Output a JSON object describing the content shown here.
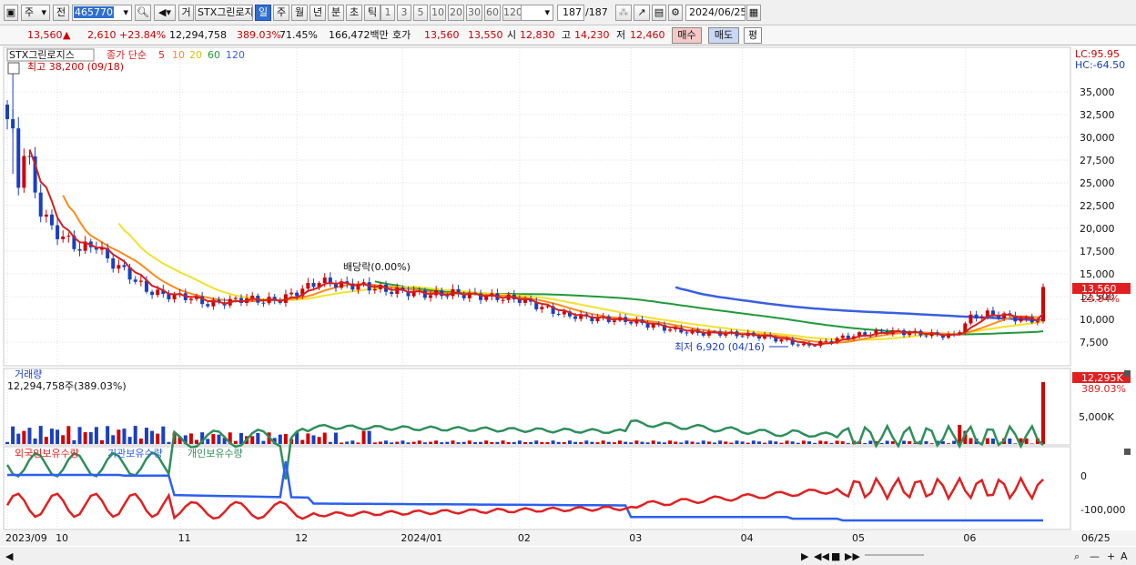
{
  "toolbar": {
    "market_type": "주",
    "market_mode": "전",
    "stock_code": "465770",
    "trade_tab": "거",
    "stock_name": "STX그린로지",
    "periods": [
      "일",
      "주",
      "월",
      "년",
      "분",
      "초",
      "틱"
    ],
    "active_period": "일",
    "intervals": [
      "1",
      "3",
      "5",
      "10",
      "20",
      "30",
      "60",
      "120"
    ],
    "count": "187",
    "total": "/187",
    "date": "2024/06/25"
  },
  "quote": {
    "price": "13,560",
    "change_arrow": "▲",
    "change": "2,610",
    "change_pct": "+23.84%",
    "volume": "12,294,758",
    "volume_ratio": "389.03%",
    "turnover": "71.45%",
    "amount": "166,472백만",
    "ask_label": "호가",
    "ask": "13,560",
    "bid": "13,550",
    "open_label": "시",
    "open": "12,830",
    "high_label": "고",
    "high": "14,230",
    "low_label": "저",
    "low": "12,460",
    "buy_button": "매수",
    "sell_button": "매도",
    "eval_button": "평"
  },
  "colors": {
    "up": "#d00000",
    "down": "#1a3fc0",
    "ma5": "#d32020",
    "ma10": "#ff8a1a",
    "ma20": "#f5e02a",
    "ma60": "#1f9a3a",
    "ma120": "#3a5fe0",
    "foreign": "#e02020",
    "institution": "#2c5ff0",
    "individual": "#2e8f5a"
  },
  "price_panel": {
    "stock_label": "STX그린로지스",
    "ma_label": "종가 단순",
    "ma_periods": [
      "5",
      "10",
      "20",
      "60",
      "120"
    ],
    "high_note": "최고 38,200 (09/18)",
    "low_note": "최저 6,920 (04/16)",
    "dividend_note": "배당락(0.00%)",
    "lc": "LC:95.95",
    "hc": "HC:-64.50",
    "current_price_tag": "13,560",
    "current_pct_tag": "23.84%",
    "y_ticks": [
      "35,000",
      "32,500",
      "30,000",
      "27,500",
      "25,000",
      "22,500",
      "20,000",
      "17,500",
      "15,000",
      "12,500",
      "10,000",
      "7,500"
    ]
  },
  "volume_panel": {
    "title": "거래량",
    "value": "12,294,758주(389.03%)",
    "tag_value": "12,295K",
    "tag_pct": "389.03%",
    "y_tick": "5,000K"
  },
  "holdings_panel": {
    "series_names": [
      "외국인보유수량",
      "기관보유수량",
      "개인보유수량"
    ],
    "y_ticks": [
      "0",
      "-100,000"
    ]
  },
  "x_axis": {
    "labels": [
      "2023/09",
      "10",
      "11",
      "12",
      "2024/01",
      "02",
      "03",
      "04",
      "05",
      "06"
    ],
    "right_label": "06/25"
  },
  "chart_data": {
    "type": "candlestick",
    "title": "",
    "ylim": [
      5500,
      38200
    ],
    "y_ticks": [
      7500,
      10000,
      12500,
      15000,
      17500,
      20000,
      22500,
      25000,
      27500,
      30000,
      32500,
      35000
    ],
    "annotations": [
      {
        "text": "최고 38,200 (09/18)",
        "value": 38200
      },
      {
        "text": "최저 6,920 (04/16)",
        "value": 6920
      },
      {
        "text": "배당락(0.00%)",
        "value": 0
      }
    ],
    "anchors": [
      [
        0,
        32000
      ],
      [
        1,
        30000
      ],
      [
        2,
        25000
      ],
      [
        3,
        28500
      ],
      [
        4,
        27000
      ],
      [
        5,
        24000
      ],
      [
        6,
        22000
      ],
      [
        8,
        20000
      ],
      [
        10,
        19000
      ],
      [
        13,
        17800
      ],
      [
        16,
        18200
      ],
      [
        18,
        16500
      ],
      [
        20,
        15800
      ],
      [
        22,
        14800
      ],
      [
        25,
        13200
      ],
      [
        28,
        12700
      ],
      [
        32,
        12500
      ],
      [
        36,
        11700
      ],
      [
        40,
        12000
      ],
      [
        43,
        12300
      ],
      [
        46,
        12000
      ],
      [
        49,
        12200
      ],
      [
        52,
        13000
      ],
      [
        56,
        14200
      ],
      [
        60,
        13800
      ],
      [
        64,
        13700
      ],
      [
        68,
        13200
      ],
      [
        72,
        13000
      ],
      [
        76,
        12700
      ],
      [
        80,
        12900
      ],
      [
        84,
        12600
      ],
      [
        88,
        12400
      ],
      [
        92,
        12200
      ],
      [
        96,
        11300
      ],
      [
        100,
        10500
      ],
      [
        104,
        10200
      ],
      [
        108,
        10000
      ],
      [
        112,
        9800
      ],
      [
        116,
        9300
      ],
      [
        120,
        8800
      ],
      [
        124,
        8500
      ],
      [
        128,
        8500
      ],
      [
        132,
        8300
      ],
      [
        136,
        8100
      ],
      [
        140,
        7600
      ],
      [
        143,
        7100
      ],
      [
        146,
        7400
      ],
      [
        150,
        8000
      ],
      [
        154,
        8400
      ],
      [
        158,
        8700
      ],
      [
        162,
        8500
      ],
      [
        166,
        8300
      ],
      [
        170,
        8200
      ],
      [
        173,
        10200
      ],
      [
        176,
        10600
      ],
      [
        179,
        10400
      ],
      [
        182,
        10000
      ],
      [
        185,
        9900
      ],
      [
        186,
        13560
      ]
    ],
    "volume_unit": "K shares",
    "volume_ylim": [
      0,
      13000
    ],
    "volume_last": 12295,
    "holdings_ylim": [
      -130000,
      40000
    ]
  }
}
